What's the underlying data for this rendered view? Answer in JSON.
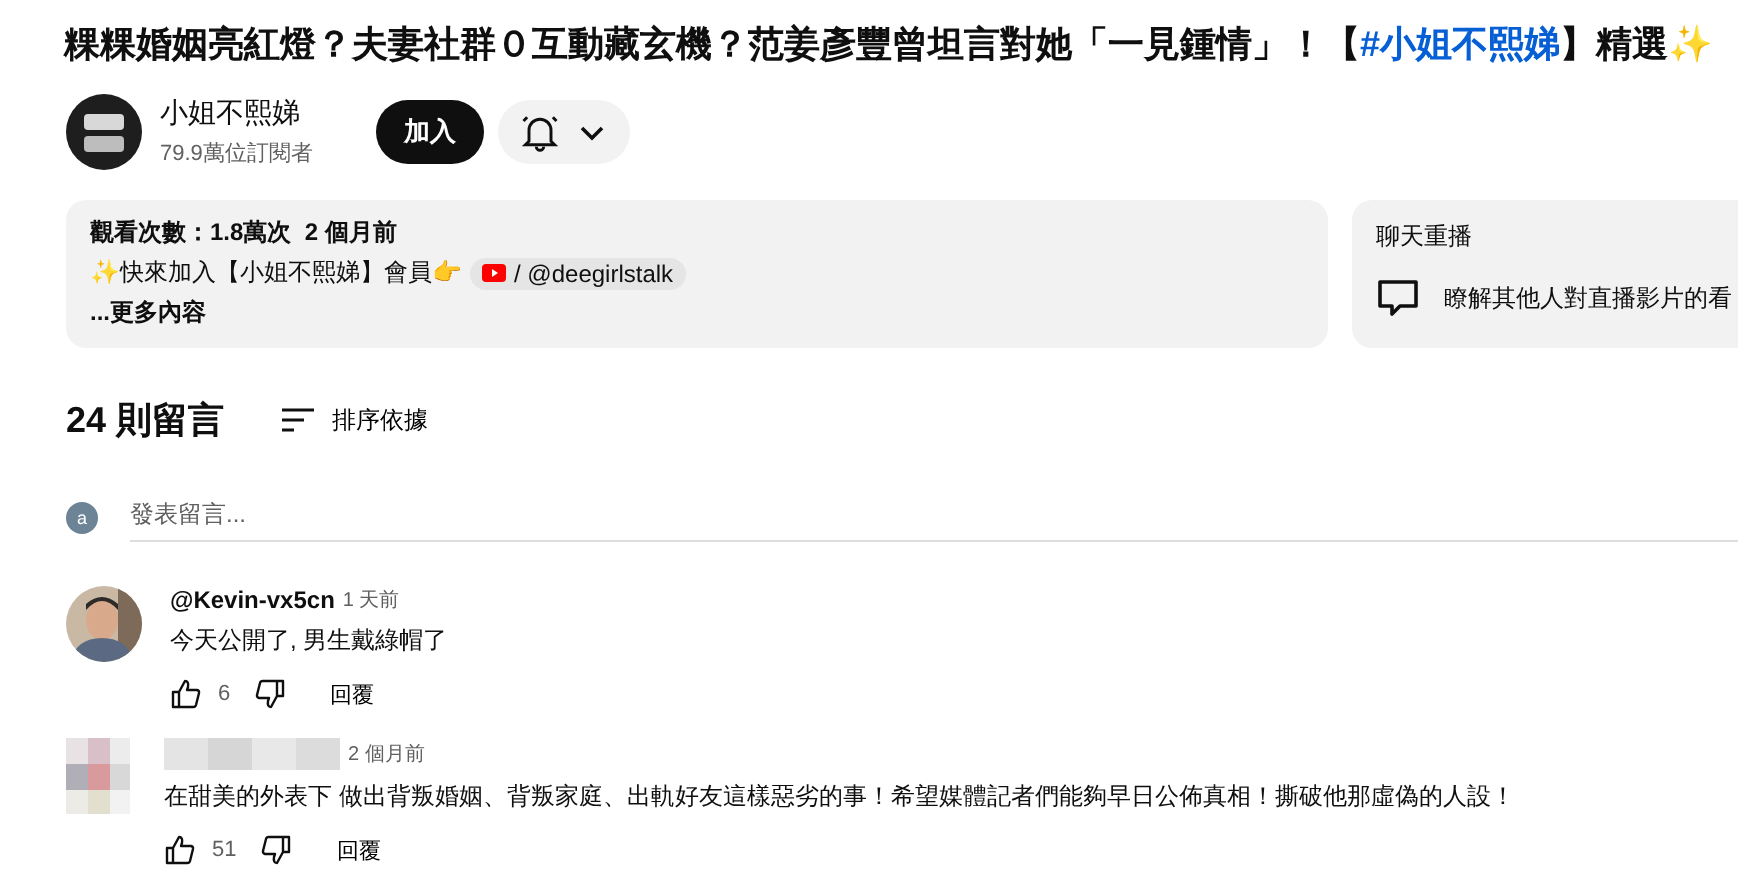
{
  "title": {
    "before": "粿粿婚姻亮紅燈？夫妻社群０互動藏玄機？范姜彥豐曾坦言對她「一見鍾情」！【",
    "hashtag": "#小姐不熙娣",
    "after": "】精選✨"
  },
  "channel": {
    "name": "小姐不熙娣",
    "subscribers": "79.9萬位訂閱者",
    "join_label": "加入"
  },
  "description": {
    "stats": "觀看次數：1.8萬次  2 個月前",
    "line_before": "✨快來加入【小姐不熙娣】會員👉",
    "chip": "/ @deegirlstalk",
    "more": "...更多內容"
  },
  "chat_replay": {
    "title": "聊天重播",
    "text": "瞭解其他人對直播影片的看"
  },
  "comments_header": {
    "count": "24 則留言",
    "sort_label": "排序依據"
  },
  "add_comment": {
    "avatar_letter": "a",
    "placeholder": "發表留言..."
  },
  "comments": [
    {
      "author": "@Kevin-vx5cn",
      "time": "1 天前",
      "text": "今天公開了, 男生戴綠帽了",
      "likes": "6",
      "reply_label": "回覆"
    },
    {
      "kind": "blurred",
      "time": "2 個月前",
      "text": "在甜美的外表下 做出背叛婚姻、背叛家庭、出軌好友這樣惡劣的事！希望媒體記者們能夠早日公佈真相！撕破他那虛偽的人設！",
      "likes": "51",
      "reply_label": "回覆"
    }
  ]
}
